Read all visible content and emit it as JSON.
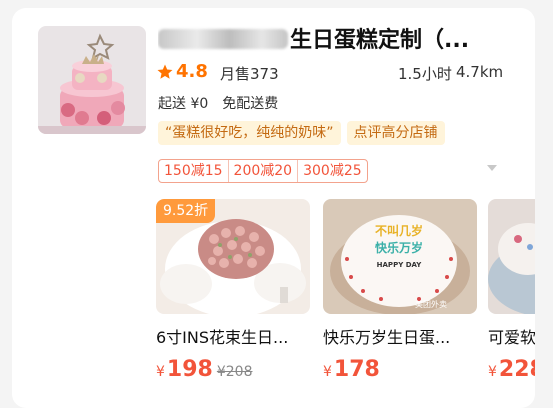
{
  "store": {
    "title_hidden_prefix": "Mi  S",
    "title_visible": "生日蛋糕定制（...",
    "rating": "4.8",
    "monthly_sales": "月售373",
    "delivery_time": "1.5小时",
    "distance": "4.7km",
    "min_order": "起送 ¥0",
    "delivery_fee": "免配送费",
    "tags": [
      "“蛋糕很好吃，纯纯的奶味”",
      "点评高分店铺"
    ],
    "coupons": [
      "150减15",
      "200减20",
      "300减25"
    ],
    "colors": {
      "accent": "#ff7300",
      "price": "#f2543a",
      "tag_bg": "#fff4da",
      "tag_text": "#c46a12",
      "discount_bg": "#ff9a3c"
    }
  },
  "products": [
    {
      "name": "6寸INS花束生日...",
      "currency": "¥",
      "price": "198",
      "original_price": "¥208",
      "discount": "9.52折"
    },
    {
      "name": "快乐万岁生日蛋...",
      "currency": "¥",
      "price": "178",
      "cake_text_top": "不叫几岁",
      "cake_text_mid": "快乐万岁",
      "cake_text_bottom": "HAPPY DAY",
      "watermark": "美团外卖"
    },
    {
      "name": "可爱软",
      "currency": "¥",
      "price": "228"
    }
  ],
  "icons": [
    "star-icon",
    "chevron-down-icon"
  ]
}
